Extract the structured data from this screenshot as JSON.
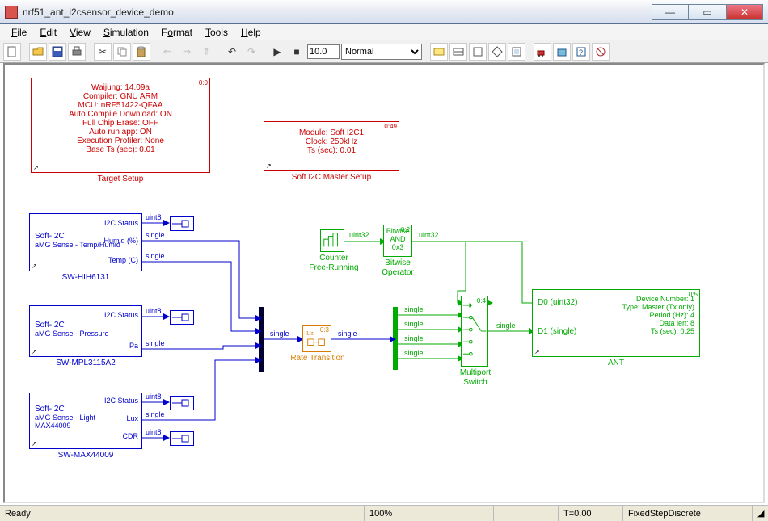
{
  "window": {
    "title": "nrf51_ant_i2csensor_device_demo"
  },
  "menu": {
    "file": "File",
    "edit": "Edit",
    "view": "View",
    "simulation": "Simulation",
    "format": "Format",
    "tools": "Tools",
    "help": "Help"
  },
  "toolbar": {
    "stoptime": "10.0",
    "mode": "Normal"
  },
  "blocks": {
    "target_setup": {
      "sample_time": "0:0",
      "lines": [
        "Waijung: 14.09a",
        "Compiler: GNU ARM",
        "MCU: nRF51422-QFAA",
        "Auto Compile Download: ON",
        "Full Chip Erase: OFF",
        "Auto run app: ON",
        "Execution Profiler: None",
        "Base Ts (sec): 0.01"
      ],
      "caption": "Target Setup"
    },
    "i2c_setup": {
      "sample_time": "0:49",
      "lines": [
        "Module: Soft I2C1",
        "Clock: 250kHz",
        "Ts (sec): 0.01"
      ],
      "caption": "Soft I2C Master Setup"
    },
    "hih": {
      "title": "Soft-I2C",
      "sub": "aMG Sense - Temp/Humid",
      "ports": [
        "I2C Status",
        "Humid (%)",
        "Temp (C)"
      ],
      "caption": "SW-HIH6131",
      "sigs": [
        "uint8",
        "single",
        "single"
      ]
    },
    "mpl": {
      "title": "Soft-I2C",
      "sub": "aMG Sense - Pressure",
      "ports": [
        "I2C Status",
        "Pa"
      ],
      "caption": "SW-MPL3115A2",
      "sigs": [
        "uint8",
        "single"
      ]
    },
    "max": {
      "title": "Soft-I2C",
      "sub": "aMG Sense - Light",
      "sub2": "MAX44009",
      "ports": [
        "I2C Status",
        "Lux",
        "CDR"
      ],
      "caption": "SW-MAX44009",
      "sigs": [
        "uint8",
        "single",
        "uint8"
      ]
    },
    "counter": {
      "caption1": "Counter",
      "caption2": "Free-Running",
      "sig": "uint32"
    },
    "bitwise": {
      "line1": "Bitwise",
      "line2": "AND",
      "line3": "0x3",
      "caption1": "Bitwise",
      "caption2": "Operator",
      "st": "0:2",
      "sig": "uint32"
    },
    "rate": {
      "caption": "Rate Transition",
      "st": "0:3",
      "sigin": "single",
      "sigout": "single"
    },
    "mps": {
      "caption1": "Multiport",
      "caption2": "Switch",
      "st": "0:4",
      "sigs": [
        "single",
        "single",
        "single",
        "single"
      ],
      "sigout": "single"
    },
    "ant": {
      "st": "0:5",
      "ports": [
        "D0 (uint32)",
        "D1 (single)"
      ],
      "lines": [
        "Device Number: 1",
        "Type: Master (Tx only)",
        "Period (Hz): 4",
        "Data len: 8",
        "Ts (sec): 0.25"
      ],
      "caption": "ANT"
    }
  },
  "status": {
    "ready": "Ready",
    "zoom": "100%",
    "time": "T=0.00",
    "solver": "FixedStepDiscrete"
  }
}
